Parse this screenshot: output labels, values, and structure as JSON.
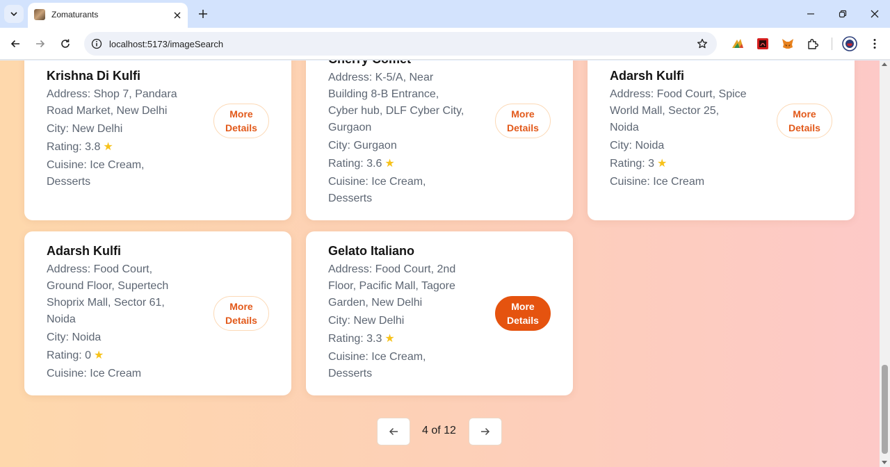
{
  "browser": {
    "tab_title": "Zomaturants",
    "url": "localhost:5173/imageSearch"
  },
  "cards": [
    {
      "name": "Krishna Di Kulfi",
      "address_lines": [
        "Address: Shop 7, Pandara",
        "Road Market, New Delhi"
      ],
      "city": "City: New Delhi",
      "rating": "Rating: 3.8",
      "cuisine_lines": [
        "Cuisine: Ice Cream,",
        "Desserts"
      ],
      "button_lines": [
        "More",
        "Details"
      ]
    },
    {
      "name": "Cherry Comet",
      "address_lines": [
        "Address: K-5/A, Near",
        "Building 8-B Entrance,",
        "Cyber hub, DLF Cyber City,",
        "Gurgaon"
      ],
      "city": "City: Gurgaon",
      "rating": "Rating: 3.6",
      "cuisine_lines": [
        "Cuisine: Ice Cream,",
        "Desserts"
      ],
      "button_lines": [
        "More",
        "Details"
      ]
    },
    {
      "name": "Adarsh Kulfi",
      "address_lines": [
        "Address: Food Court, Spice",
        "World Mall, Sector 25,",
        "Noida"
      ],
      "city": "City: Noida",
      "rating": "Rating: 3",
      "cuisine_lines": [
        "Cuisine: Ice Cream"
      ],
      "button_lines": [
        "More",
        "Details"
      ]
    },
    {
      "name": "Adarsh Kulfi",
      "address_lines": [
        "Address: Food Court,",
        "Ground Floor, Supertech",
        "Shoprix Mall, Sector 61,",
        "Noida"
      ],
      "city": "City: Noida",
      "rating": "Rating: 0",
      "cuisine_lines": [
        "Cuisine: Ice Cream"
      ],
      "button_lines": [
        "More",
        "Details"
      ]
    },
    {
      "name": "Gelato Italiano",
      "address_lines": [
        "Address: Food Court, 2nd",
        "Floor, Pacific Mall, Tagore",
        "Garden, New Delhi"
      ],
      "city": "City: New Delhi",
      "rating": "Rating: 3.3",
      "cuisine_lines": [
        "Cuisine: Ice Cream,",
        "Desserts"
      ],
      "button_lines": [
        "More",
        "Details"
      ]
    }
  ],
  "pagination": {
    "label": "4 of 12",
    "prev_icon": "arrow-left-icon",
    "next_icon": "arrow-right-icon"
  },
  "colors": {
    "accent": "#e5530f",
    "star": "#f7c21b",
    "page_gradient_start": "#fed8ac",
    "page_gradient_end": "#fdc9c7"
  }
}
